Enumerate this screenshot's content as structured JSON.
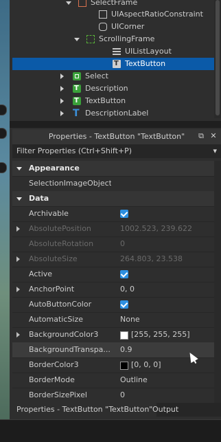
{
  "explorer": {
    "items": [
      {
        "label": "SelectFrame",
        "icon": "frame-icon",
        "expand": "down"
      },
      {
        "label": "UIAspectRatioConstraint",
        "icon": "aspect-ratio-icon",
        "expand": "none"
      },
      {
        "label": "UICorner",
        "icon": "corner-icon",
        "expand": "none"
      },
      {
        "label": "ScrollingFrame",
        "icon": "scrolling-frame-icon",
        "expand": "down"
      },
      {
        "label": "UIListLayout",
        "icon": "list-layout-icon",
        "expand": "none"
      },
      {
        "label": "TextButton",
        "icon": "text-button-icon",
        "expand": "none",
        "selected": true
      },
      {
        "label": "Select",
        "icon": "image-button-icon",
        "expand": "right"
      },
      {
        "label": "Description",
        "icon": "text-label-icon",
        "expand": "right"
      },
      {
        "label": "TextButton",
        "icon": "text-label-icon",
        "expand": "right"
      },
      {
        "label": "DescriptionLabel",
        "icon": "text-icon",
        "expand": "right"
      }
    ]
  },
  "properties": {
    "title": "Properties - TextButton \"TextButton\"",
    "filter_placeholder": "Filter Properties (Ctrl+Shift+P)",
    "rows": [
      {
        "type": "section",
        "name": "Appearance"
      },
      {
        "type": "prop",
        "name": "SelectionImageObject",
        "value": ""
      },
      {
        "type": "section",
        "name": "Data"
      },
      {
        "type": "prop",
        "name": "Archivable",
        "value": "",
        "checkbox": true
      },
      {
        "type": "prop",
        "name": "AbsolutePosition",
        "value": "1002.523, 239.622",
        "dim": true,
        "expand": true
      },
      {
        "type": "prop",
        "name": "AbsoluteRotation",
        "value": "0",
        "dim": true
      },
      {
        "type": "prop",
        "name": "AbsoluteSize",
        "value": "264.803, 23.538",
        "dim": true,
        "expand": true
      },
      {
        "type": "prop",
        "name": "Active",
        "value": "",
        "checkbox": true
      },
      {
        "type": "prop",
        "name": "AnchorPoint",
        "value": "0, 0",
        "expand": true
      },
      {
        "type": "prop",
        "name": "AutoButtonColor",
        "value": "",
        "checkbox": true
      },
      {
        "type": "prop",
        "name": "AutomaticSize",
        "value": "None"
      },
      {
        "type": "prop",
        "name": "BackgroundColor3",
        "value": "[255, 255, 255]",
        "swatch": "#ffffff",
        "expand": true
      },
      {
        "type": "prop",
        "name": "BackgroundTranspa...",
        "value": "0.9",
        "highlight": true
      },
      {
        "type": "prop",
        "name": "BorderColor3",
        "value": "[0, 0, 0]",
        "swatch": "#000000"
      },
      {
        "type": "prop",
        "name": "BorderMode",
        "value": "Outline"
      },
      {
        "type": "prop",
        "name": "BorderSizePixel",
        "value": "0"
      }
    ]
  },
  "tabs": [
    {
      "label": "Properties - TextButton \"TextButton\"",
      "active": true
    },
    {
      "label": "Output",
      "active": false
    }
  ],
  "header_buttons": {
    "float": "⧉",
    "close": "✕"
  },
  "filter_chevron": "▾"
}
